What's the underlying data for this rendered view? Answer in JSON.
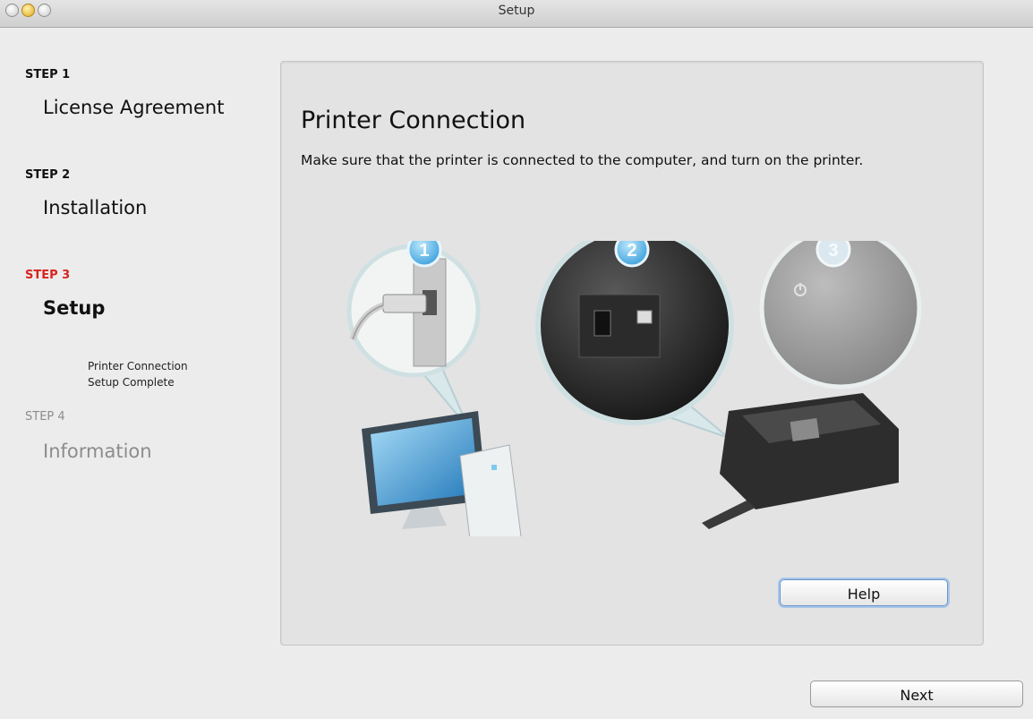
{
  "window": {
    "title": "Setup"
  },
  "sidebar": {
    "steps": [
      {
        "tag": "STEP 1",
        "title": "License Agreement"
      },
      {
        "tag": "STEP 2",
        "title": "Installation"
      },
      {
        "tag": "STEP 3",
        "title": "Setup"
      },
      {
        "tag": "STEP 4",
        "title": "Information"
      }
    ],
    "substeps": [
      "Printer Connection",
      "Setup Complete"
    ]
  },
  "main": {
    "title": "Printer Connection",
    "description": "Make sure that the printer is connected to the computer, and turn on the printer.",
    "illustration_numbers": [
      "1",
      "2",
      "3"
    ]
  },
  "buttons": {
    "help": "Help",
    "next": "Next"
  },
  "colors": {
    "active_step": "#d8231c",
    "dim_step": "#8c8c8c",
    "badge": "#49a9df"
  }
}
